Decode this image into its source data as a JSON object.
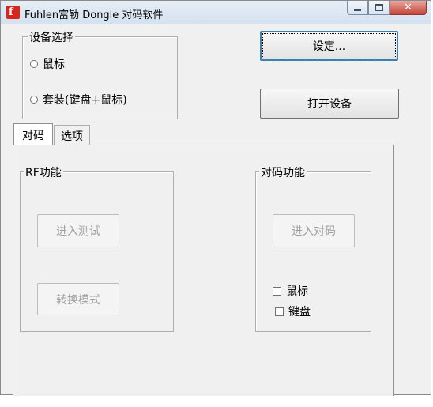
{
  "window": {
    "title": "Fuhlen富勒 Dongle 对码软件",
    "icon": "app-logo-icon",
    "controls": {
      "minimize": "minimize-icon",
      "maximize": "maximize-icon",
      "close": "✕"
    }
  },
  "device_select": {
    "legend": "设备选择",
    "options": [
      "鼠标",
      "套装(键盘+鼠标)"
    ]
  },
  "buttons": {
    "settings": "设定...",
    "open_device": "打开设备"
  },
  "tabs": [
    "对码",
    "选项"
  ],
  "rf_group": {
    "legend": "RF功能",
    "enter_test": "进入测试",
    "switch_mode": "转换模式"
  },
  "pair_group": {
    "legend": "对码功能",
    "enter_pair": "进入对码",
    "checkboxes": [
      "鼠标",
      "键盘"
    ]
  }
}
